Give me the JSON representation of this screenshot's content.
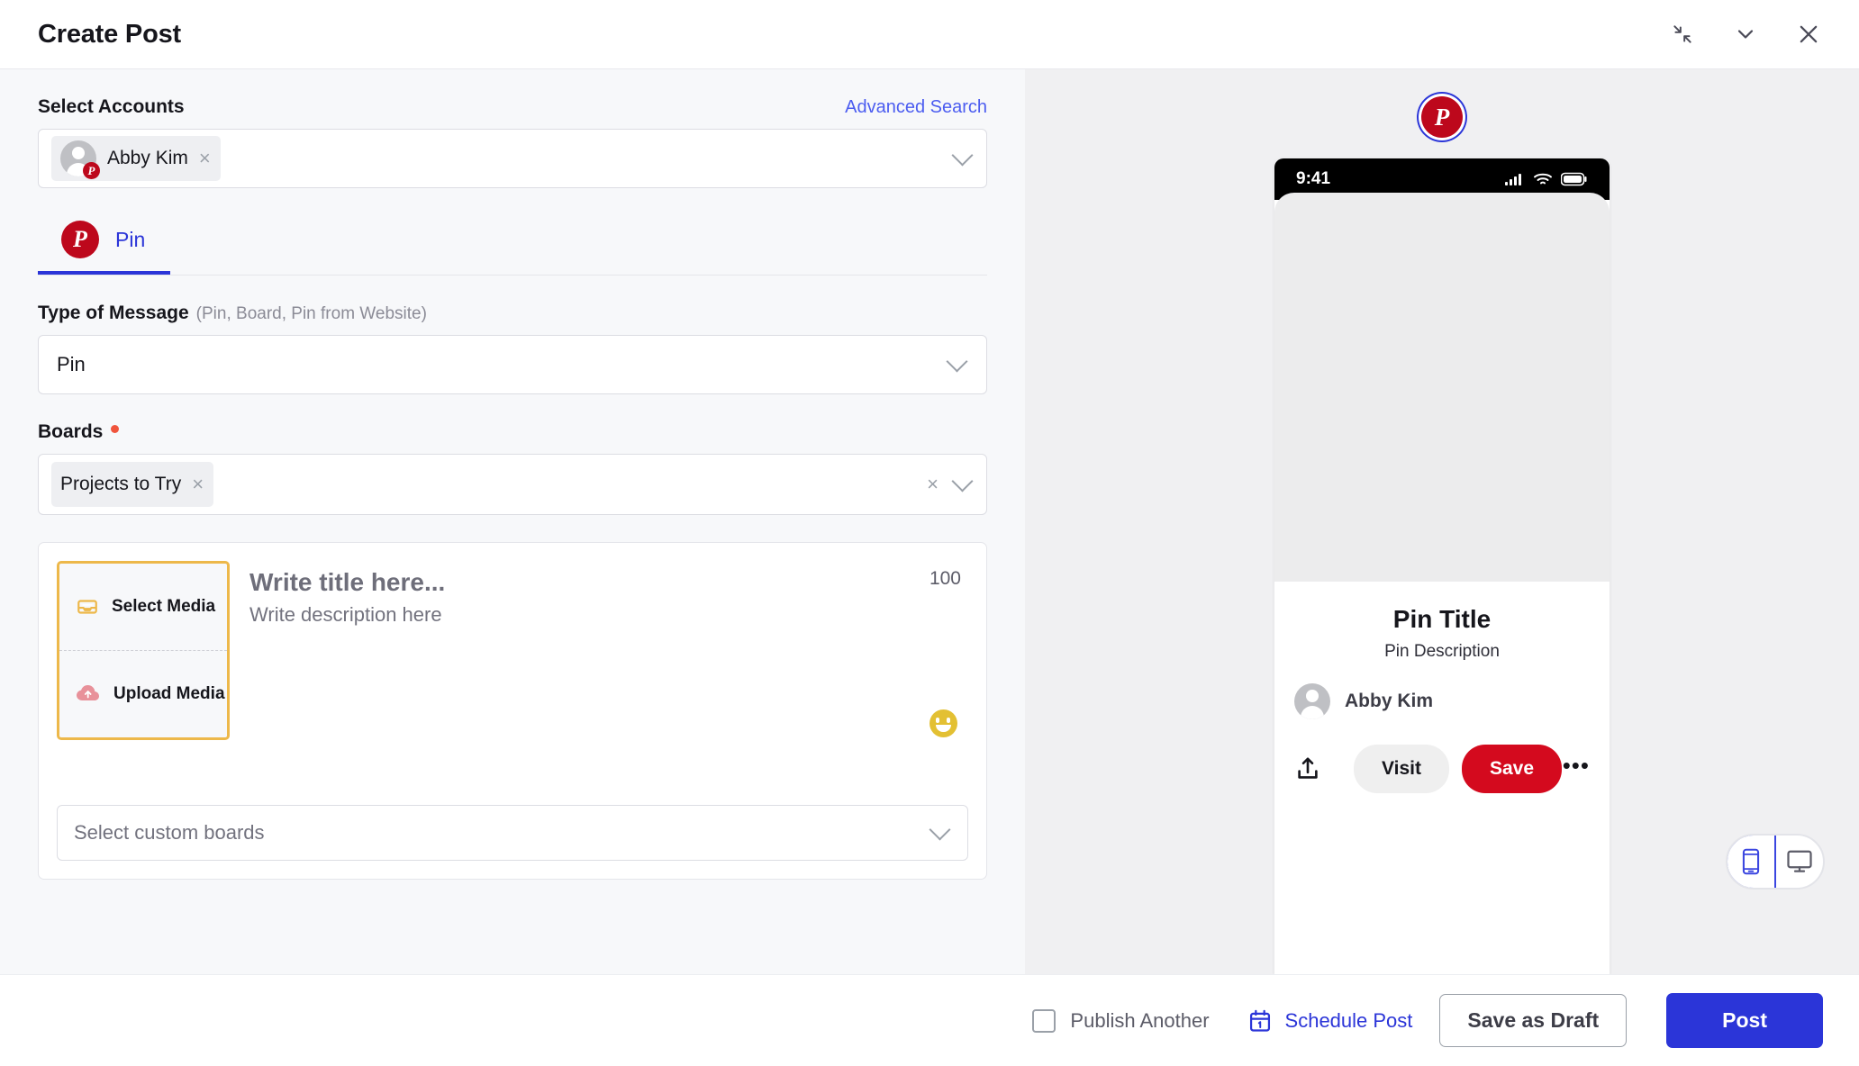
{
  "window": {
    "title": "Create Post",
    "actions": [
      {
        "name": "collapse-icon",
        "label": "Collapse"
      },
      {
        "name": "chevron-down-icon",
        "label": "Minimize"
      },
      {
        "name": "close-icon",
        "label": "Close"
      }
    ]
  },
  "accounts": {
    "label": "Select Accounts",
    "advanced_search": "Advanced Search",
    "selected": [
      {
        "name": "Abby Kim",
        "network": "pinterest",
        "remove": "×"
      }
    ]
  },
  "tabs": [
    {
      "id": "pin",
      "label": "Pin",
      "network": "pinterest",
      "active": true
    }
  ],
  "message_type": {
    "label": "Type of Message",
    "hint": "(Pin, Board, Pin from Website)",
    "value": "Pin",
    "options": [
      "Pin",
      "Board",
      "Pin from Website"
    ]
  },
  "boards": {
    "label": "Boards",
    "required": true,
    "selected": [
      {
        "name": "Projects to Try",
        "remove": "×"
      }
    ],
    "clear": "×"
  },
  "composer": {
    "select_media": "Select Media",
    "upload_media": "Upload Media",
    "title_placeholder": "Write title here...",
    "description_placeholder": "Write description here",
    "char_counter": "100",
    "emoji_button": "emoji-picker",
    "custom_boards_placeholder": "Select custom boards"
  },
  "preview": {
    "network": "pinterest",
    "status_bar": {
      "time": "9:41",
      "icons": [
        "cellular-signal-icon",
        "wifi-icon",
        "battery-icon"
      ]
    },
    "pin_title": "Pin Title",
    "pin_description": "Pin Description",
    "author": "Abby Kim",
    "buttons": {
      "visit": "Visit",
      "save": "Save",
      "share": "share-icon",
      "more": "•••"
    },
    "device_toggle": {
      "mobile": "mobile-view",
      "desktop": "desktop-view",
      "active": "mobile-view"
    }
  },
  "footer": {
    "publish_another": "Publish Another",
    "publish_another_checked": false,
    "schedule_post": "Schedule Post",
    "save_as_draft": "Save as Draft",
    "post": "Post"
  },
  "colors": {
    "brand_blue": "#2b35d8",
    "pinterest_red": "#bd081c",
    "save_red": "#d40a1e",
    "media_border": "#edb84a",
    "required_dot": "#f0543c",
    "link_blue": "#4b5cf0"
  }
}
